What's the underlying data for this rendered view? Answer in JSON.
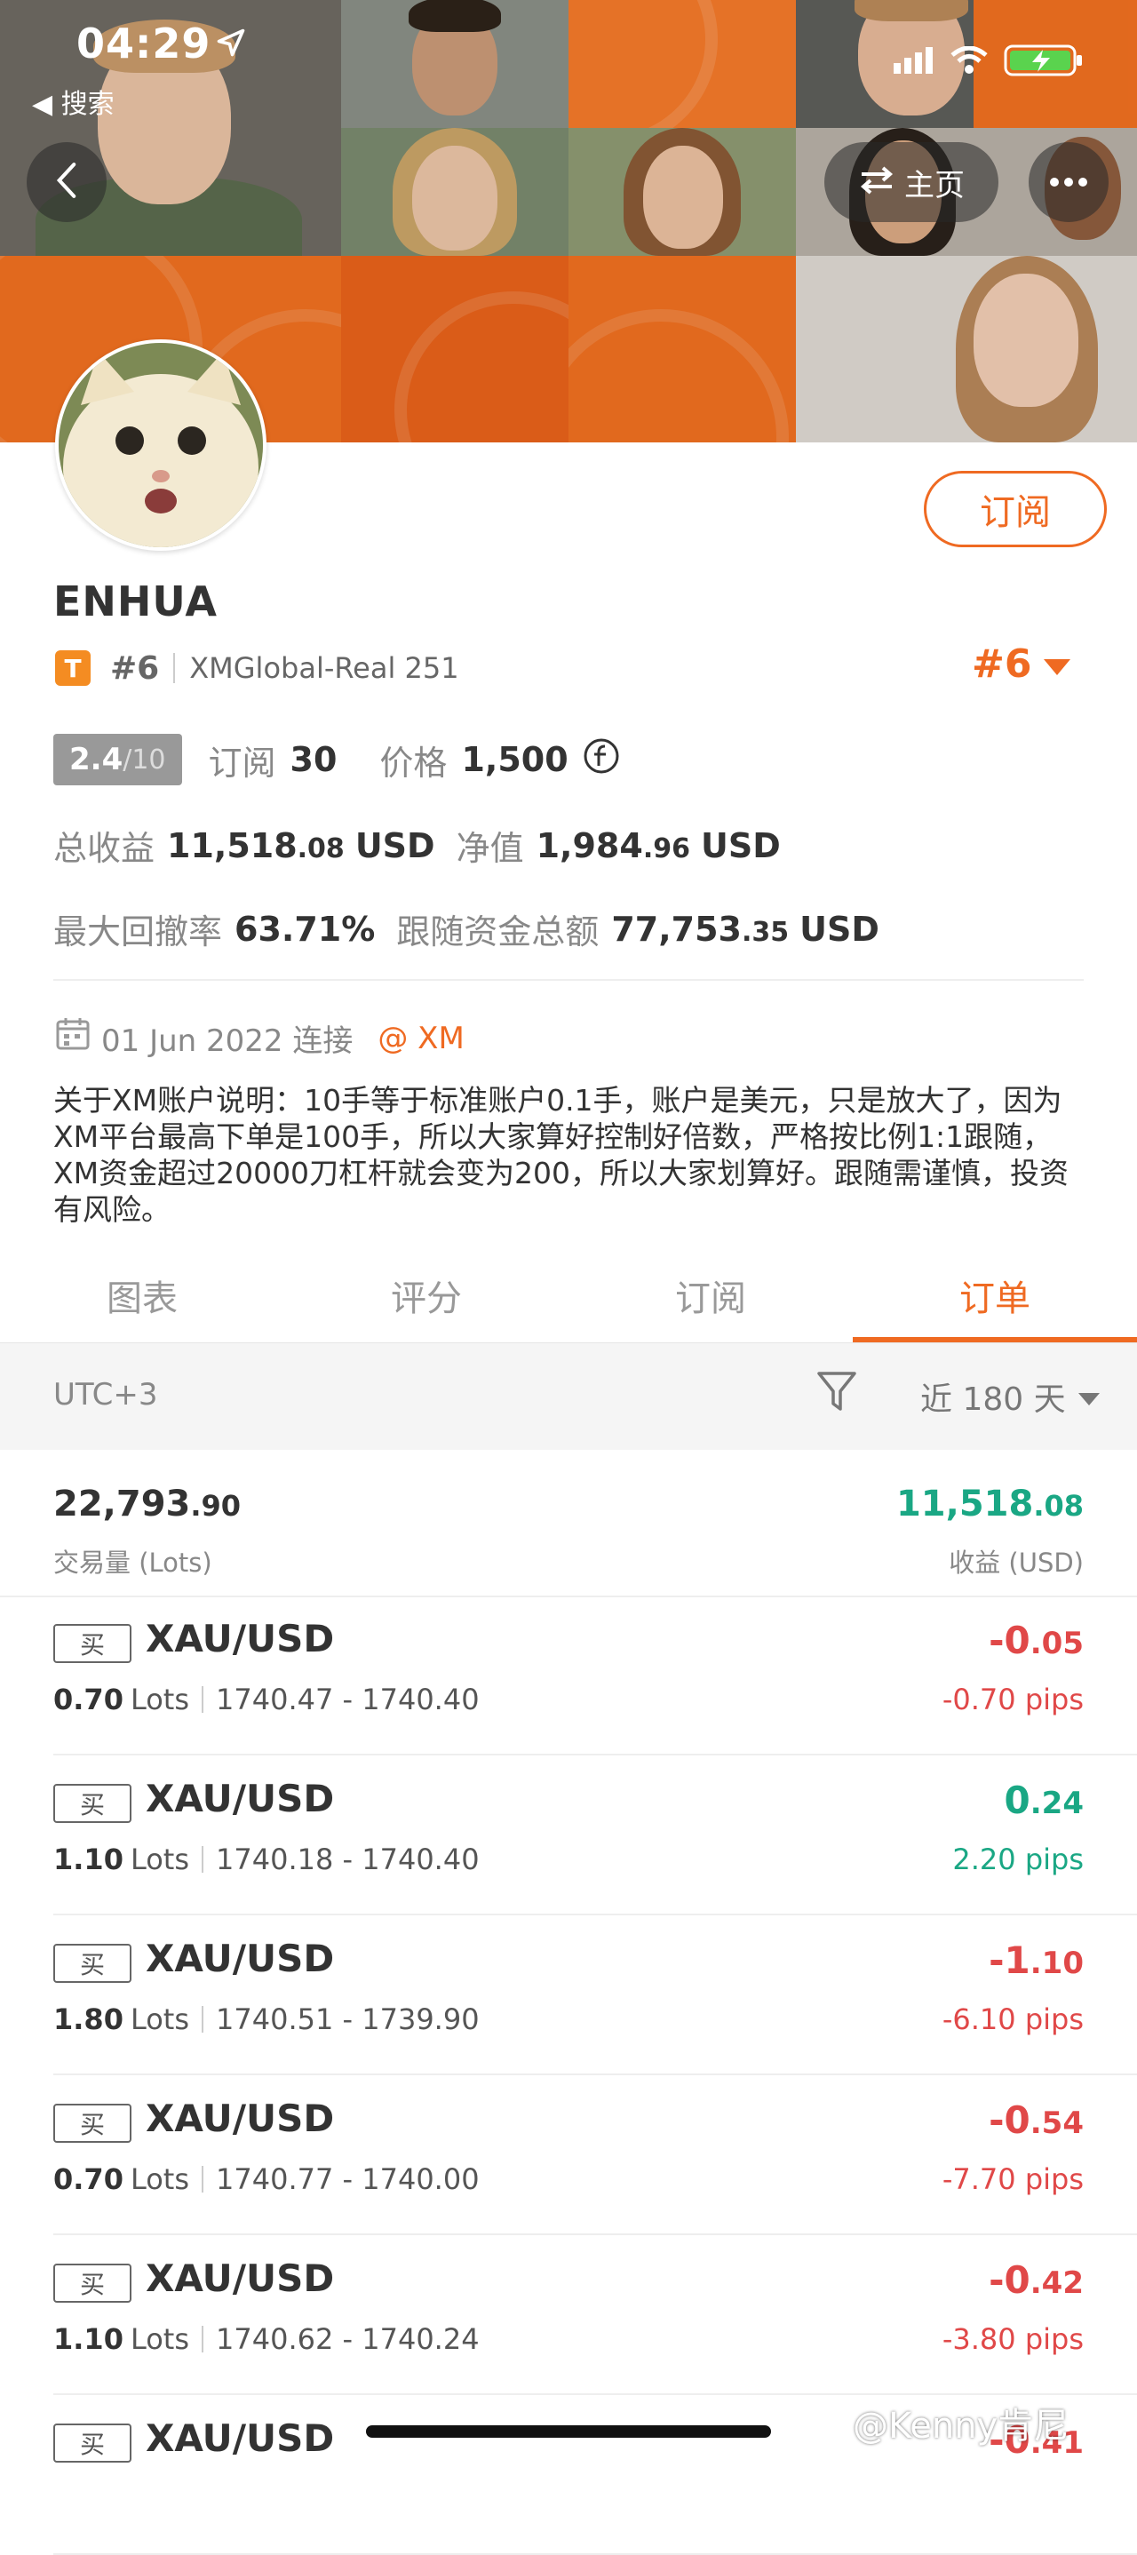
{
  "status_bar": {
    "time": "04:29",
    "back_app_label": "◀ 搜索"
  },
  "nav": {
    "home_label": "主页"
  },
  "profile": {
    "subscribe_label": "订阅",
    "name": "ENHUA",
    "tier_badge": "T",
    "rank_small": "#6",
    "account": "XMGlobal-Real 251",
    "rank_big": "#6",
    "score": "2.4",
    "score_total": "/10",
    "subscribe_count_label": "订阅",
    "subscribe_count": "30",
    "price_label": "价格",
    "price_value": "1,500",
    "total_profit_label": "总收益",
    "total_profit_int": "11,518",
    "total_profit_dec": ".08",
    "total_profit_unit": "USD",
    "equity_label": "净值",
    "equity_int": "1,984",
    "equity_dec": ".96",
    "equity_unit": "USD",
    "max_drawdown_label": "最大回撤率",
    "max_drawdown_value": "63.71%",
    "follow_funds_label": "跟随资金总额",
    "follow_funds_int": "77,753",
    "follow_funds_dec": ".35",
    "follow_funds_unit": "USD",
    "connected_date": "01 Jun 2022 连接",
    "broker": "@ XM",
    "description": "关于XM账户说明：10手等于标准账户0.1手，账户是美元，只是放大了，因为XM平台最高下单是100手，所以大家算好控制好倍数，严格按比例1:1跟随，XM资金超过20000刀杠杆就会变为200，所以大家划算好。跟随需谨慎，投资有风险。"
  },
  "tabs": [
    "图表",
    "评分",
    "订阅",
    "订单"
  ],
  "active_tab": "订单",
  "filter": {
    "timezone": "UTC+3",
    "period": "近 180 天"
  },
  "summary": {
    "volume_int": "22,793",
    "volume_dec": ".90",
    "volume_label": "交易量 (Lots)",
    "profit_int": "11,518",
    "profit_dec": ".08",
    "profit_label": "收益 (USD)"
  },
  "trades": [
    {
      "side": "买",
      "symbol": "XAU/USD",
      "lots": "0.70",
      "lots_unit": "Lots",
      "prices": "1740.47 - 1740.40",
      "profit_int": "-0",
      "profit_dec": ".05",
      "pips": "-0.70 pips",
      "direction": "neg"
    },
    {
      "side": "买",
      "symbol": "XAU/USD",
      "lots": "1.10",
      "lots_unit": "Lots",
      "prices": "1740.18 - 1740.40",
      "profit_int": "0",
      "profit_dec": ".24",
      "pips": "2.20 pips",
      "direction": "pos"
    },
    {
      "side": "买",
      "symbol": "XAU/USD",
      "lots": "1.80",
      "lots_unit": "Lots",
      "prices": "1740.51 - 1739.90",
      "profit_int": "-1",
      "profit_dec": ".10",
      "pips": "-6.10 pips",
      "direction": "neg"
    },
    {
      "side": "买",
      "symbol": "XAU/USD",
      "lots": "0.70",
      "lots_unit": "Lots",
      "prices": "1740.77 - 1740.00",
      "profit_int": "-0",
      "profit_dec": ".54",
      "pips": "-7.70 pips",
      "direction": "neg"
    },
    {
      "side": "买",
      "symbol": "XAU/USD",
      "lots": "1.10",
      "lots_unit": "Lots",
      "prices": "1740.62 - 1740.24",
      "profit_int": "-0",
      "profit_dec": ".42",
      "pips": "-3.80 pips",
      "direction": "neg"
    },
    {
      "side": "买",
      "symbol": "XAU/USD",
      "lots": "",
      "lots_unit": "",
      "prices": "",
      "profit_int": "-0",
      "profit_dec": ".41",
      "pips": "",
      "direction": "neg"
    }
  ],
  "watermark": "@Kenny肯尼",
  "colors": {
    "accent": "#ef6a22",
    "negative": "#e04848",
    "positive": "#1aa784"
  },
  "icons": [
    "location-arrow-icon",
    "signal-icon",
    "wifi-icon",
    "battery-charging-icon",
    "back-chevron-icon",
    "switch-arrows-icon",
    "more-dots-icon",
    "tier-badge-icon",
    "triangle-down-icon",
    "currency-coin-icon",
    "calendar-icon",
    "filter-funnel-icon"
  ]
}
